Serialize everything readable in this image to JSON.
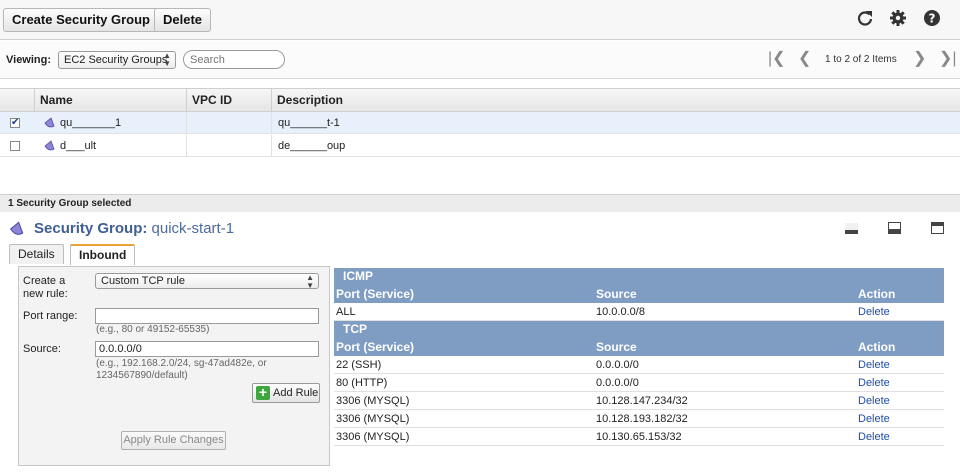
{
  "toolbar": {
    "create_label": "Create Security Group",
    "delete_label": "Delete"
  },
  "viewbar": {
    "viewing_label": "Viewing:",
    "view_select": "EC2 Security Groups",
    "search_placeholder": "Search",
    "page_info": "1 to 2 of 2 Items"
  },
  "grid": {
    "columns": [
      "Name",
      "VPC ID",
      "Description"
    ],
    "rows": [
      {
        "name": "qu_______1",
        "vpc": "",
        "description": "qu______t-1",
        "checked": true
      },
      {
        "name": "d___ult",
        "vpc": "",
        "description": "de______oup",
        "checked": false
      }
    ]
  },
  "selection_status": "1 Security Group selected",
  "detail": {
    "title_prefix": "Security Group:",
    "title_name": "quick-start-1"
  },
  "tabs": [
    "Details",
    "Inbound"
  ],
  "form": {
    "create_rule_label": "Create a new rule:",
    "rule_type": "Custom TCP rule",
    "port_range_label": "Port range:",
    "port_range_value": "",
    "port_hint": "(e.g., 80 or 49152-65535)",
    "source_label": "Source:",
    "source_value": "0.0.0.0/0",
    "source_hint": "(e.g., 192.168.2.0/24, sg-47ad482e, or 1234567890/default)",
    "add_rule_label": "Add Rule",
    "apply_label": "Apply Rule Changes"
  },
  "rules": {
    "headers": [
      "Port (Service)",
      "Source",
      "Action"
    ],
    "icmp_title": "ICMP",
    "icmp_rows": [
      {
        "port": "ALL",
        "source": "10.0.0.0/8",
        "action": "Delete"
      }
    ],
    "tcp_title": "TCP",
    "tcp_rows": [
      {
        "port": "22 (SSH)",
        "source": "0.0.0.0/0",
        "action": "Delete"
      },
      {
        "port": "80 (HTTP)",
        "source": "0.0.0.0/0",
        "action": "Delete"
      },
      {
        "port": "3306 (MYSQL)",
        "source": "10.128.147.234/32",
        "action": "Delete"
      },
      {
        "port": "3306 (MYSQL)",
        "source": "10.128.193.182/32",
        "action": "Delete"
      },
      {
        "port": "3306 (MYSQL)",
        "source": "10.130.65.153/32",
        "action": "Delete"
      }
    ]
  },
  "icons": {
    "refresh": "refresh-icon",
    "settings": "gear-icon",
    "help": "help-icon",
    "security_group": "security-group-icon"
  },
  "colors": {
    "section_header": "#7f9cc3",
    "link": "#1f4fa8",
    "title": "#4b6a9e",
    "tab_accent": "#e8a23a"
  }
}
